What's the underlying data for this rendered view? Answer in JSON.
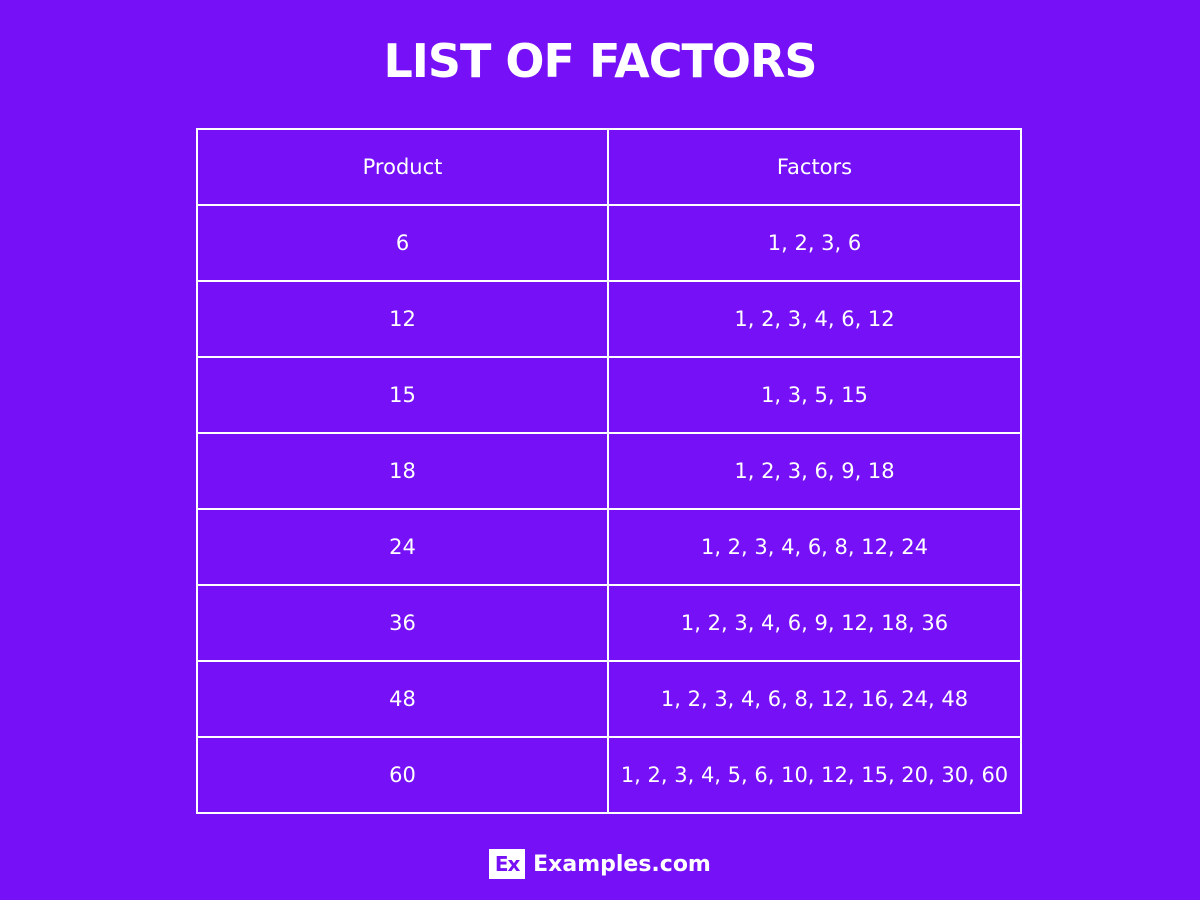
{
  "title": "LIST OF FACTORS",
  "table": {
    "headers": [
      "Product",
      "Factors"
    ],
    "rows": [
      [
        "6",
        "1, 2, 3, 6"
      ],
      [
        "12",
        "1, 2, 3, 4, 6, 12"
      ],
      [
        "15",
        "1, 3, 5, 15"
      ],
      [
        "18",
        "1, 2, 3, 6, 9, 18"
      ],
      [
        "24",
        "1, 2, 3, 4, 6, 8, 12, 24"
      ],
      [
        "36",
        "1, 2, 3, 4, 6, 9, 12, 18, 36"
      ],
      [
        "48",
        "1, 2, 3, 4, 6, 8, 12, 16, 24, 48"
      ],
      [
        "60",
        "1, 2, 3, 4, 5, 6, 10, 12, 15, 20, 30, 60"
      ]
    ]
  },
  "brand": {
    "logo_text": "Ex",
    "name": "Examples.com"
  },
  "colors": {
    "background": "#7610f7",
    "foreground": "#ffffff"
  }
}
